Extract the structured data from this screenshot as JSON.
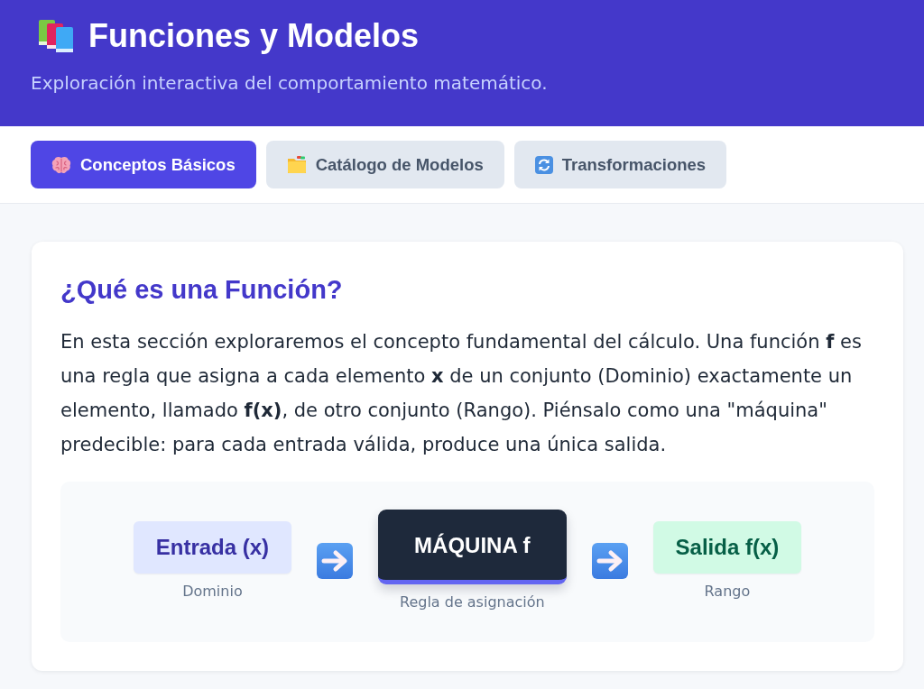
{
  "header": {
    "title": "Funciones y Modelos",
    "subtitle": "Exploración interactiva del comportamiento matemático."
  },
  "tabs": [
    {
      "label": "Conceptos Básicos",
      "selected": true
    },
    {
      "label": "Catálogo de Modelos",
      "selected": false
    },
    {
      "label": "Transformaciones",
      "selected": false
    }
  ],
  "section": {
    "heading": "¿Qué es una Función?",
    "text": "En esta sección exploraremos el concepto fundamental del cálculo. Una función **f** es una regla que asigna a cada elemento **x** de un conjunto (Dominio) exactamente un elemento, llamado **f(x)**, de otro conjunto (Rango). Piénsalo como una \"máquina\" predecible: para cada entrada válida, produce una única salida.",
    "diagram": {
      "nodes": [
        {
          "kind": "input",
          "label": "Entrada (x)",
          "caption": "Dominio"
        },
        {
          "kind": "machine",
          "label": "MÁQUINA f",
          "caption": "Regla de asignación"
        },
        {
          "kind": "output",
          "label": "Salida f(x)",
          "caption": "Rango"
        }
      ]
    }
  }
}
